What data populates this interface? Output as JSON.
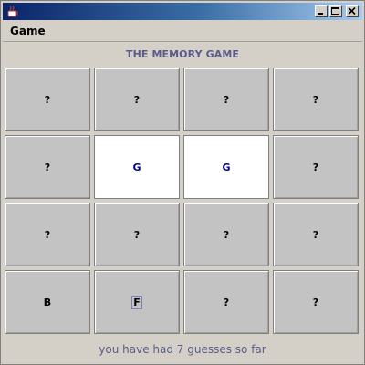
{
  "window": {
    "app_icon": "java-cup-icon",
    "controls": [
      "minimize-icon",
      "maximize-icon",
      "close-icon"
    ]
  },
  "menu": {
    "game_label": "Game"
  },
  "heading": "THE MEMORY GAME",
  "cards": [
    {
      "label": "?",
      "state": "hidden"
    },
    {
      "label": "?",
      "state": "hidden"
    },
    {
      "label": "?",
      "state": "hidden"
    },
    {
      "label": "?",
      "state": "hidden"
    },
    {
      "label": "?",
      "state": "hidden"
    },
    {
      "label": "G",
      "state": "revealed"
    },
    {
      "label": "G",
      "state": "revealed"
    },
    {
      "label": "?",
      "state": "hidden"
    },
    {
      "label": "?",
      "state": "hidden"
    },
    {
      "label": "?",
      "state": "hidden"
    },
    {
      "label": "?",
      "state": "hidden"
    },
    {
      "label": "?",
      "state": "hidden"
    },
    {
      "label": "B",
      "state": "matched"
    },
    {
      "label": "F",
      "state": "focused"
    },
    {
      "label": "?",
      "state": "hidden"
    },
    {
      "label": "?",
      "state": "hidden"
    }
  ],
  "status": "you have had 7 guesses so far",
  "colors": {
    "title_gradient_start": "#0a246a",
    "title_gradient_end": "#a6caf0",
    "heading_text": "#5b5b8a",
    "revealed_text": "#00008b",
    "card_hidden": "#c3c3c3",
    "card_revealed": "#ffffff"
  }
}
